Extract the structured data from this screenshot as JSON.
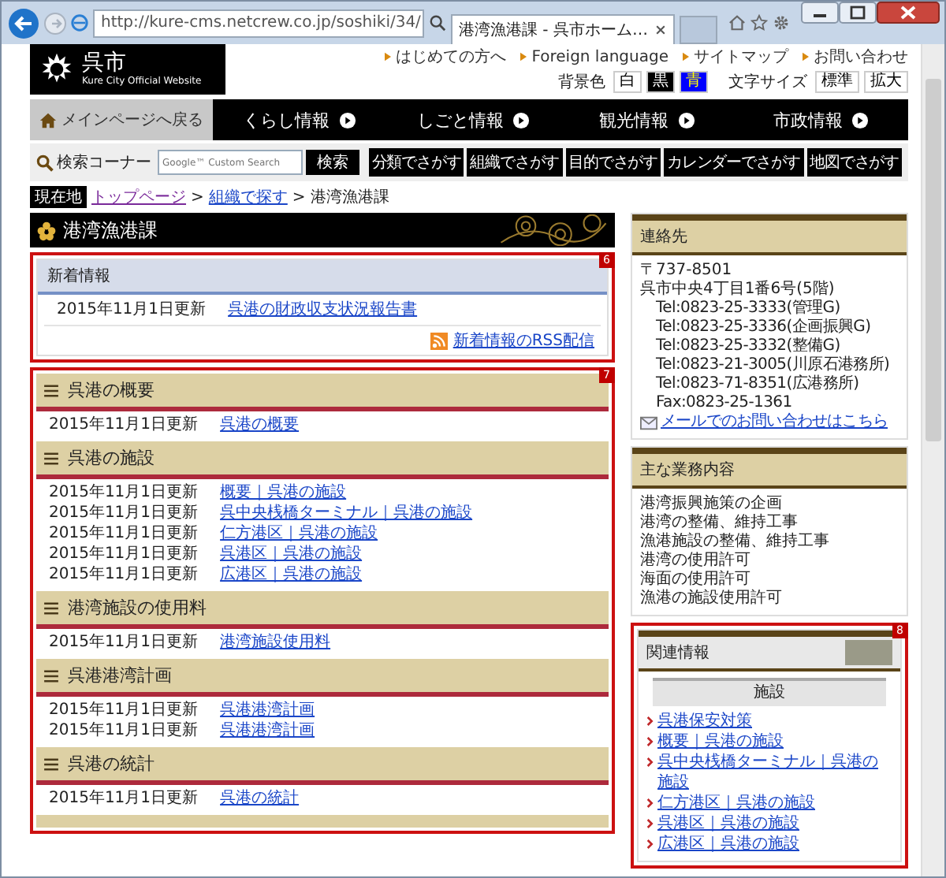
{
  "browser": {
    "url": "http://kure-cms.netcrew.co.jp/soshiki/34/",
    "tab_title": "港湾漁港課 - 呉市ホーム…"
  },
  "header": {
    "logo_text": "呉市",
    "logo_subtitle": "Kure City Official Website",
    "links": [
      "はじめての方へ",
      "Foreign language",
      "サイトマップ",
      "お問い合わせ"
    ],
    "background_color": {
      "label": "背景色",
      "options": [
        {
          "label": "白",
          "kind": "white"
        },
        {
          "label": "黒",
          "kind": "black"
        },
        {
          "label": "青",
          "kind": "blue"
        }
      ]
    },
    "text_size": {
      "label": "文字サイズ",
      "options": [
        "標準",
        "拡大"
      ]
    }
  },
  "nav": {
    "home": "メインページへ戻る",
    "items": [
      "くらし情報",
      "しごと情報",
      "観光情報",
      "市政情報"
    ]
  },
  "search": {
    "label": "検索コーナー",
    "placeholder": "Google™ Custom Search",
    "button": "検索",
    "finders": [
      "分類でさがす",
      "組織でさがす",
      "目的でさがす",
      "カレンダーでさがす",
      "地図でさがす"
    ]
  },
  "breadcrumb": {
    "label": "現在地",
    "separator": ">",
    "links": [
      {
        "text": "トップページ",
        "visited": true
      },
      {
        "text": "組織で探す",
        "visited": false
      }
    ],
    "current": "港湾漁港課"
  },
  "page_title": "港湾漁港課",
  "news": {
    "callout": "6",
    "title": "新着情報",
    "items": [
      {
        "date": "2015年11月1日更新",
        "link": "呉港の財政収支状況報告書"
      }
    ],
    "rss": "新着情報のRSS配信"
  },
  "sections": {
    "callout": "7",
    "items": [
      {
        "title": "呉港の概要",
        "entries": [
          {
            "date": "2015年11月1日更新",
            "link": "呉港の概要"
          }
        ]
      },
      {
        "title": "呉港の施設",
        "entries": [
          {
            "date": "2015年11月1日更新",
            "link": "概要｜呉港の施設"
          },
          {
            "date": "2015年11月1日更新",
            "link": "呉中央桟橋ターミナル｜呉港の施設"
          },
          {
            "date": "2015年11月1日更新",
            "link": "仁方港区｜呉港の施設"
          },
          {
            "date": "2015年11月1日更新",
            "link": "呉港区｜呉港の施設"
          },
          {
            "date": "2015年11月1日更新",
            "link": "広港区｜呉港の施設"
          }
        ]
      },
      {
        "title": "港湾施設の使用料",
        "entries": [
          {
            "date": "2015年11月1日更新",
            "link": "港湾施設使用料"
          }
        ]
      },
      {
        "title": "呉港港湾計画",
        "entries": [
          {
            "date": "2015年11月1日更新",
            "link": "呉港港湾計画"
          },
          {
            "date": "2015年11月1日更新",
            "link": "呉港港湾計画"
          }
        ]
      },
      {
        "title": "呉港の統計",
        "entries": [
          {
            "date": "2015年11月1日更新",
            "link": "呉港の統計"
          }
        ]
      }
    ]
  },
  "sidebar": {
    "contact": {
      "title": "連絡先",
      "postal": "〒737-8501",
      "address": "呉市中央4丁目1番6号(5階)",
      "lines": [
        "Tel:0823-25-3333(管理G)",
        "Tel:0823-25-3336(企画振興G)",
        "Tel:0823-25-3332(整備G)",
        "Tel:0823-21-3005(川原石港務所)",
        "Tel:0823-71-8351(広港務所)",
        "Fax:0823-25-1361"
      ],
      "mail_link": "メールでのお問い合わせはこちら"
    },
    "duties": {
      "title": "主な業務内容",
      "items": [
        "港湾振興施策の企画",
        "港湾の整備、維持工事",
        "漁港施設の整備、維持工事",
        "港湾の使用許可",
        "海面の使用許可",
        "漁港の施設使用許可"
      ]
    },
    "related": {
      "callout": "8",
      "title": "関連情報",
      "subheading": "施設",
      "links": [
        "呉港保安対策",
        "概要｜呉港の施設",
        "呉中央桟橋ターミナル｜呉港の施設",
        "仁方港区｜呉港の施設",
        "呉港区｜呉港の施設",
        "広港区｜呉港の施設"
      ]
    }
  }
}
